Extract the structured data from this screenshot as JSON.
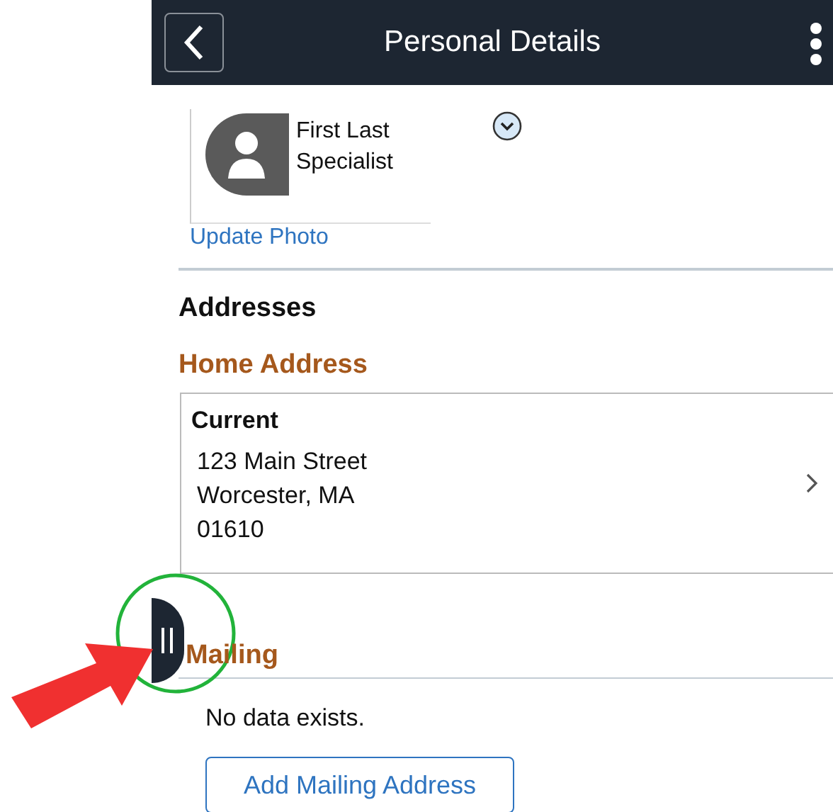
{
  "header": {
    "title": "Personal Details"
  },
  "profile": {
    "name": "First Last",
    "role": "Specialist",
    "update_photo": "Update Photo"
  },
  "addresses": {
    "title": "Addresses",
    "home": {
      "title": "Home Address",
      "card_label": "Current",
      "lines": [
        "123 Main Street",
        "Worcester, MA",
        "01610"
      ]
    },
    "mailing": {
      "title": "Mailing",
      "empty_message": "No data exists.",
      "add_button": "Add Mailing Address"
    }
  }
}
